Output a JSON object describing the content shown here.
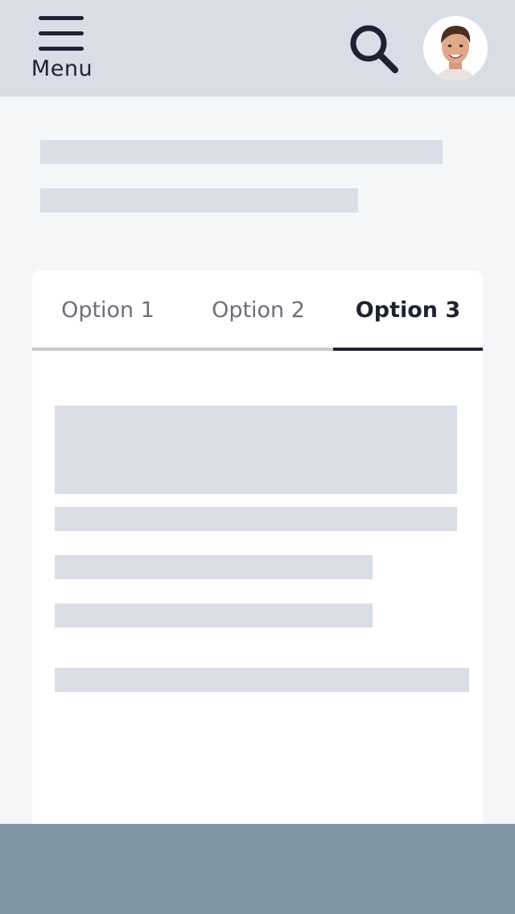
{
  "header": {
    "menu_label": "Menu",
    "search_icon": "search-icon",
    "menu_icon": "hamburger-menu-icon",
    "avatar_icon": "user-avatar"
  },
  "tabs": [
    {
      "label": "Option 1",
      "active": false
    },
    {
      "label": "Option 2",
      "active": false
    },
    {
      "label": "Option 3",
      "active": true
    }
  ],
  "colors": {
    "header_bg": "#d9dee6",
    "page_bg": "#f4f6f8",
    "skeleton": "#d9dee6",
    "text_dark": "#1f2233",
    "text_muted": "#6d6f78",
    "footer_bg": "#7e95a3"
  }
}
